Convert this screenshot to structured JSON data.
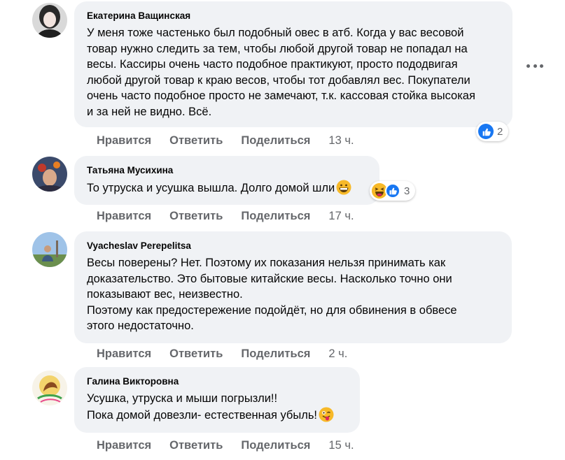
{
  "actions": {
    "like": "Нравится",
    "reply": "Ответить",
    "share": "Поделиться"
  },
  "colors": {
    "bubble": "#f0f2f5",
    "action_text": "#65676b",
    "like_blue": "#1877f2",
    "haha_yellow": "#f7b928"
  },
  "comments": [
    {
      "author": "Екатерина Ващинская",
      "lines": [
        "У меня тоже частенько был подобный овес в атб. Когда у вас весовой",
        "товар нужно следить за тем, чтобы любой другой товар не попадал на",
        "весы. Кассиры очень часто подобное практикуют, просто пододвигая",
        "любой другой товар к краю весов, чтобы тот добавлял вес. Покупатели",
        "очень часто подобное просто не замечают, т.к. кассовая стойка высокая",
        "и за ней не видно. Всё."
      ],
      "time": "13 ч.",
      "reactions": {
        "icons": [
          "like-icon"
        ],
        "count": "2"
      }
    },
    {
      "author": "Татьяна Мусихина",
      "lines": [
        "То утруска и усушка вышла. Долго домой шли"
      ],
      "trailing_emoji": "grinning-face-emoji",
      "time": "17 ч.",
      "reactions": {
        "icons": [
          "haha-icon",
          "like-icon"
        ],
        "count": "3"
      }
    },
    {
      "author": "Vyacheslav Perepelitsa",
      "lines": [
        "Весы поверены? Нет. Поэтому их показания нельзя принимать как",
        "доказательство. Это бытовые китайские весы. Насколько точно они",
        "показывают вес, неизвестно.",
        "Поэтому как предостережение подойдёт, но для обвинения в обвесе",
        "этого недостаточно."
      ],
      "time": "2 ч."
    },
    {
      "author": "Галина Викторовна",
      "lines": [
        "Усушка, утруска и мыши погрызли!!",
        "Пока домой довезли- естественная убыль!"
      ],
      "trailing_emoji": "winking-tongue-emoji",
      "time": "15 ч."
    }
  ]
}
